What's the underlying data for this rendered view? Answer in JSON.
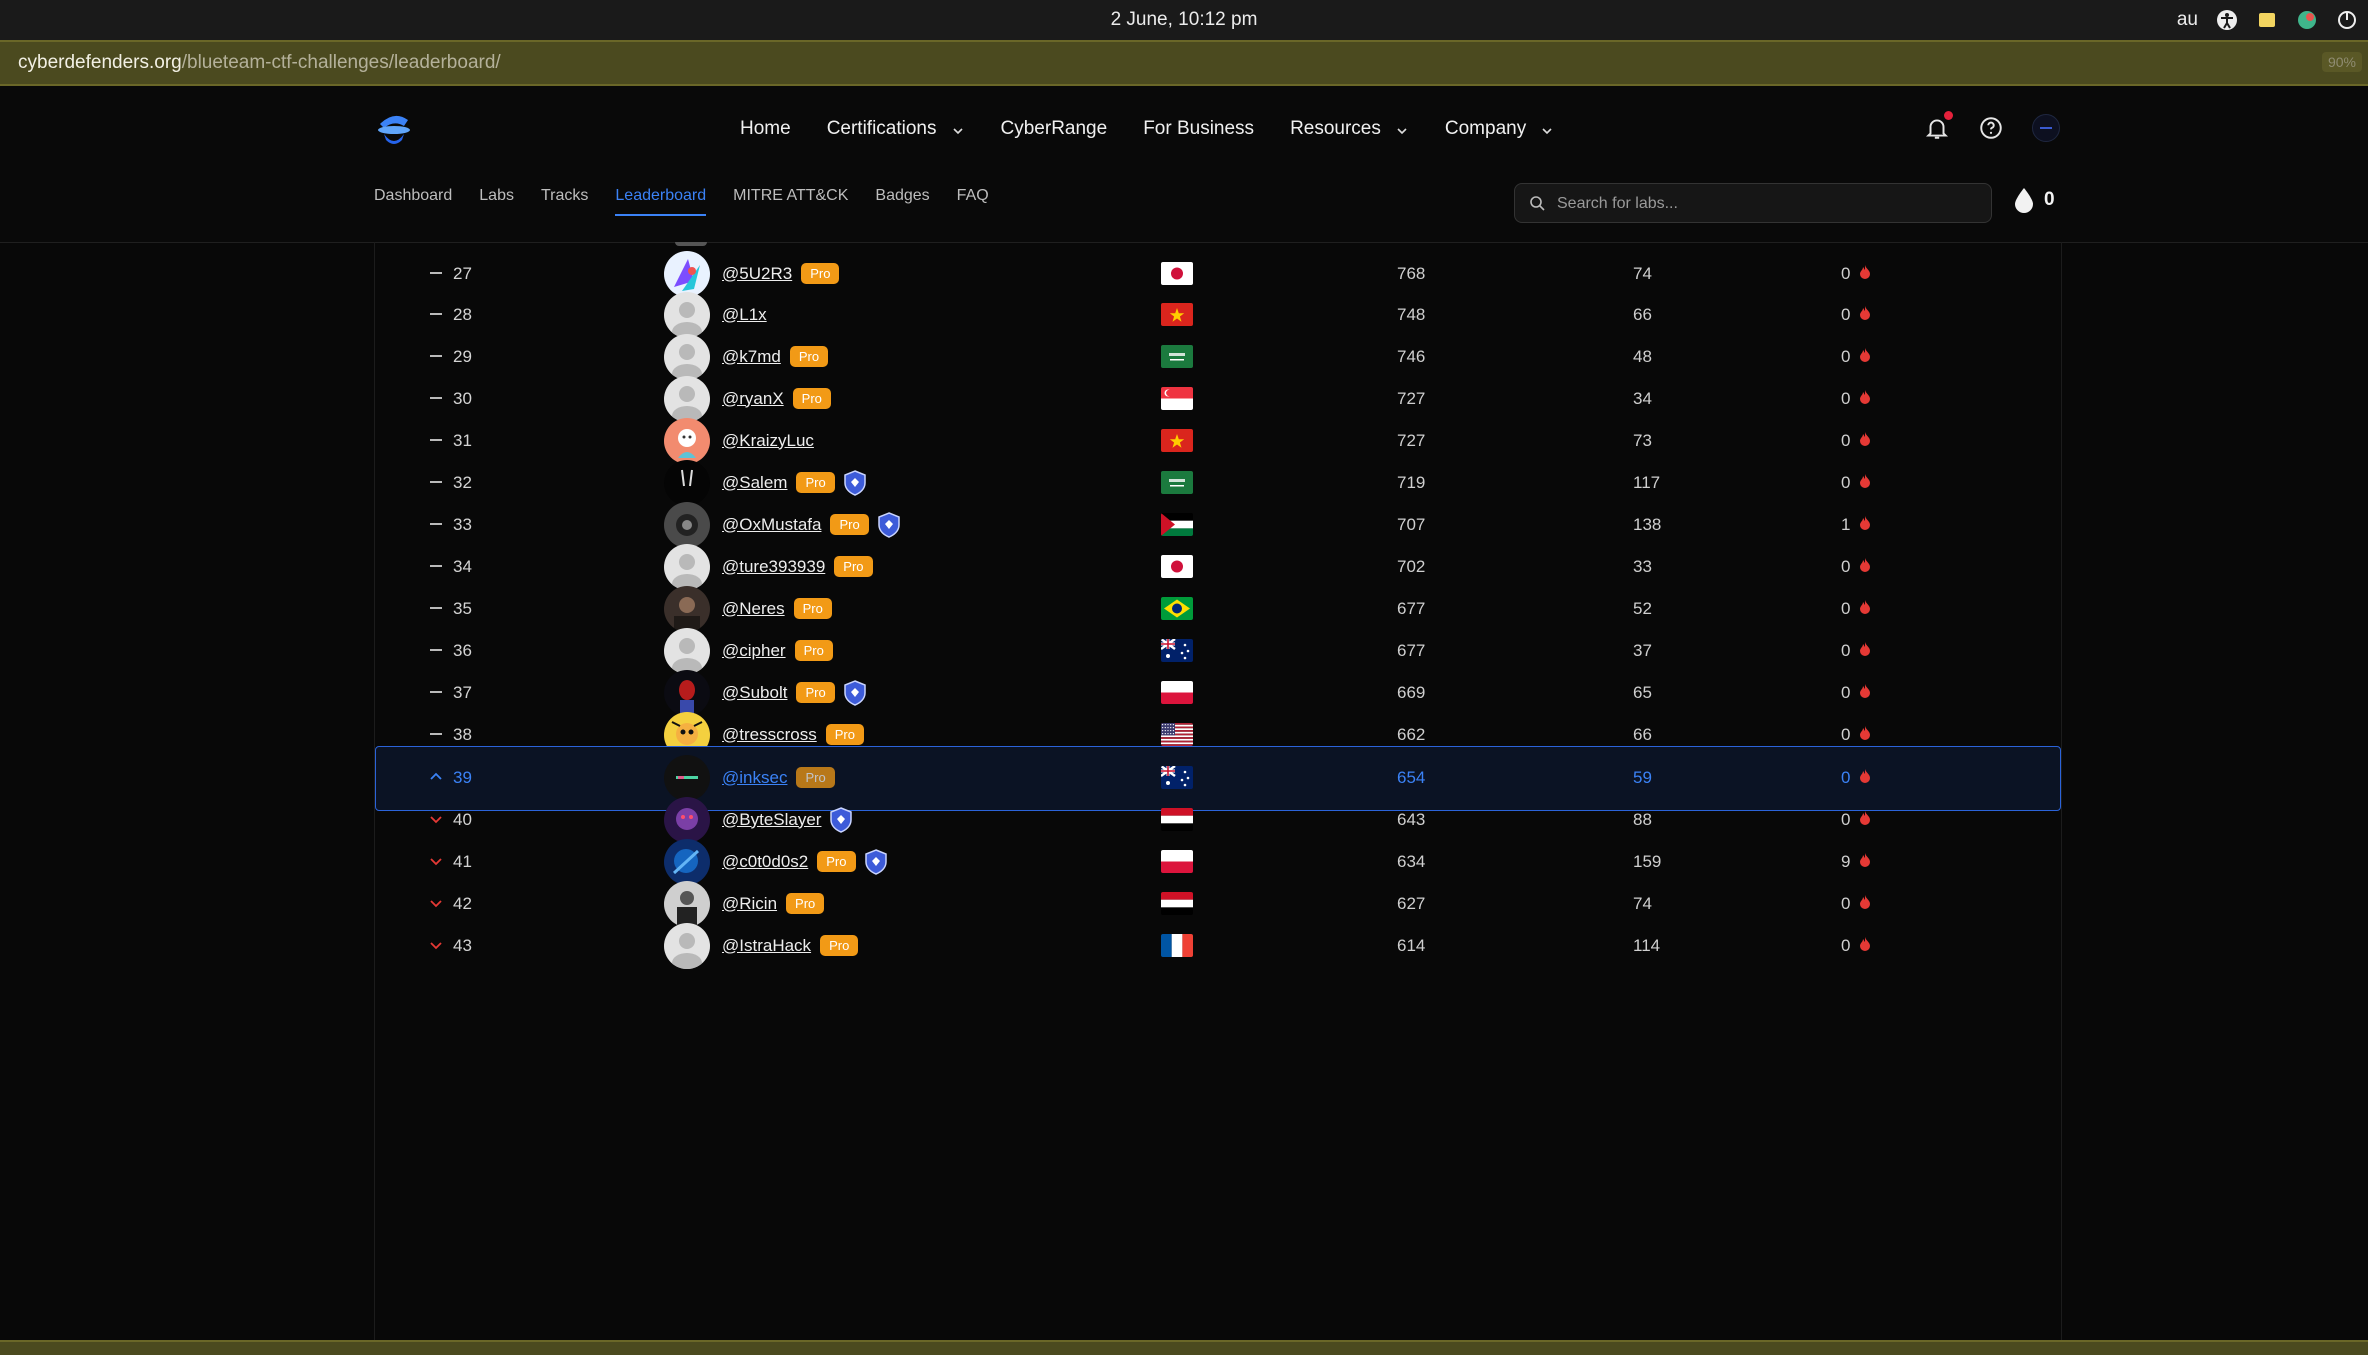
{
  "os": {
    "clock": "2 June, 10:12 pm",
    "lang": "au"
  },
  "browser": {
    "url_host": "cyberdefenders.org",
    "url_path": "/blueteam-ctf-challenges/leaderboard/",
    "zoom": "90%"
  },
  "nav": {
    "items": [
      {
        "label": "Home",
        "dropdown": false
      },
      {
        "label": "Certifications",
        "dropdown": true
      },
      {
        "label": "CyberRange",
        "dropdown": false
      },
      {
        "label": "For Business",
        "dropdown": false
      },
      {
        "label": "Resources",
        "dropdown": true
      },
      {
        "label": "Company",
        "dropdown": true
      }
    ]
  },
  "subnav": {
    "items": [
      "Dashboard",
      "Labs",
      "Tracks",
      "Leaderboard",
      "MITRE ATT&CK",
      "Badges",
      "FAQ"
    ],
    "active": "Leaderboard"
  },
  "search": {
    "placeholder": "Search for labs..."
  },
  "points": {
    "value": "0"
  },
  "colors": {
    "accent": "#3b82f6",
    "pro_badge": "#f29a16",
    "streak_flame": "#e53935"
  },
  "leaderboard": {
    "rows": [
      {
        "trend": "same",
        "rank": "27",
        "user": "@5U2R3",
        "pro": true,
        "shield": false,
        "country": "Japan",
        "score": "768",
        "labs": "74",
        "streak": "0",
        "avatar": "art"
      },
      {
        "trend": "same",
        "rank": "28",
        "user": "@L1x",
        "pro": false,
        "shield": false,
        "country": "Vietnam",
        "score": "748",
        "labs": "66",
        "streak": "0",
        "avatar": "default"
      },
      {
        "trend": "same",
        "rank": "29",
        "user": "@k7md",
        "pro": true,
        "shield": false,
        "country": "Saudi Arabia",
        "score": "746",
        "labs": "48",
        "streak": "0",
        "avatar": "default"
      },
      {
        "trend": "same",
        "rank": "30",
        "user": "@ryanX",
        "pro": true,
        "shield": false,
        "country": "Singapore",
        "score": "727",
        "labs": "34",
        "streak": "0",
        "avatar": "default"
      },
      {
        "trend": "same",
        "rank": "31",
        "user": "@KraizyLuc",
        "pro": false,
        "shield": false,
        "country": "Vietnam",
        "score": "727",
        "labs": "73",
        "streak": "0",
        "avatar": "pink"
      },
      {
        "trend": "same",
        "rank": "32",
        "user": "@Salem",
        "pro": true,
        "shield": true,
        "country": "Saudi Arabia",
        "score": "719",
        "labs": "117",
        "streak": "0",
        "avatar": "dark"
      },
      {
        "trend": "same",
        "rank": "33",
        "user": "@OxMustafa",
        "pro": true,
        "shield": true,
        "country": "Jordan",
        "score": "707",
        "labs": "138",
        "streak": "1",
        "avatar": "grey"
      },
      {
        "trend": "same",
        "rank": "34",
        "user": "@ture393939",
        "pro": true,
        "shield": false,
        "country": "Japan",
        "score": "702",
        "labs": "33",
        "streak": "0",
        "avatar": "default"
      },
      {
        "trend": "same",
        "rank": "35",
        "user": "@Neres",
        "pro": true,
        "shield": false,
        "country": "Brazil",
        "score": "677",
        "labs": "52",
        "streak": "0",
        "avatar": "photo"
      },
      {
        "trend": "same",
        "rank": "36",
        "user": "@cipher",
        "pro": true,
        "shield": false,
        "country": "Australia",
        "score": "677",
        "labs": "37",
        "streak": "0",
        "avatar": "default"
      },
      {
        "trend": "same",
        "rank": "37",
        "user": "@Subolt",
        "pro": true,
        "shield": true,
        "country": "Poland",
        "score": "669",
        "labs": "65",
        "streak": "0",
        "avatar": "spider"
      },
      {
        "trend": "same",
        "rank": "38",
        "user": "@tresscross",
        "pro": true,
        "shield": false,
        "country": "United States",
        "score": "662",
        "labs": "66",
        "streak": "0",
        "avatar": "yellow"
      },
      {
        "trend": "up",
        "rank": "39",
        "user": "@inksec",
        "pro": true,
        "shield": false,
        "country": "Australia",
        "score": "654",
        "labs": "59",
        "streak": "0",
        "avatar": "logo",
        "highlight": true
      },
      {
        "trend": "down",
        "rank": "40",
        "user": "@ByteSlayer",
        "pro": false,
        "shield": true,
        "country": "Yemen",
        "score": "643",
        "labs": "88",
        "streak": "0",
        "avatar": "purple"
      },
      {
        "trend": "down",
        "rank": "41",
        "user": "@c0t0d0s2",
        "pro": true,
        "shield": true,
        "country": "Poland",
        "score": "634",
        "labs": "159",
        "streak": "9",
        "avatar": "blue"
      },
      {
        "trend": "down",
        "rank": "42",
        "user": "@Ricin",
        "pro": true,
        "shield": false,
        "country": "Yemen",
        "score": "627",
        "labs": "74",
        "streak": "0",
        "avatar": "photo2"
      },
      {
        "trend": "down",
        "rank": "43",
        "user": "@IstraHack",
        "pro": true,
        "shield": false,
        "country": "France",
        "score": "614",
        "labs": "114",
        "streak": "0",
        "avatar": "default"
      }
    ],
    "pro_label": "Pro"
  }
}
